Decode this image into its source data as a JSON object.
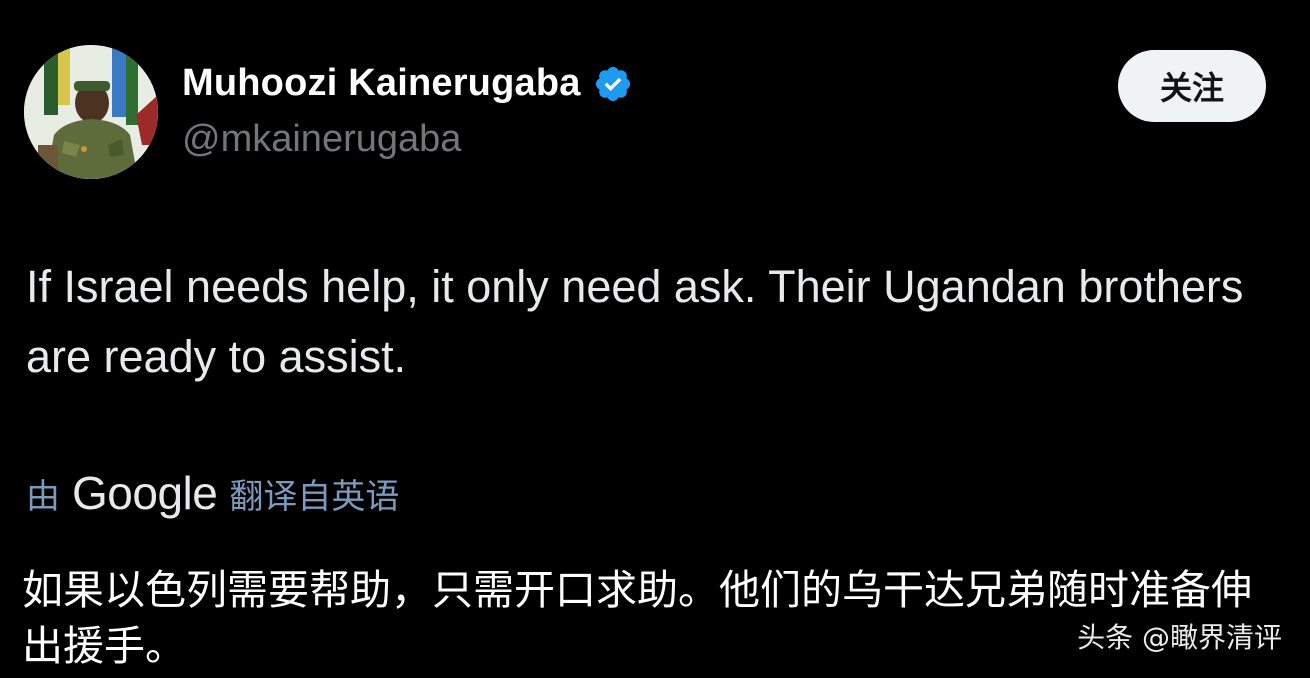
{
  "author": {
    "display_name": "Muhoozi Kainerugaba",
    "handle": "@mkainerugaba",
    "verified": true,
    "avatar_icon": "avatar-photo-icon",
    "verified_icon": "verified-badge-icon"
  },
  "follow_button": {
    "label": "关注"
  },
  "tweet": {
    "text": "If Israel needs help, it only need ask. Their Ugandan brothers are ready to assist."
  },
  "translation": {
    "prefix": "由",
    "provider": "Google",
    "link_label": "翻译自英语",
    "text": "如果以色列需要帮助，只需开口求助。他们的乌干达兄弟随时准备伸出援手。"
  },
  "watermark": {
    "text": "头条 @瞰界清评"
  },
  "colors": {
    "background": "#000000",
    "text_primary": "#e7e9ea",
    "text_secondary": "#71767b",
    "link": "#7a9bbd",
    "verified": "#1d9bf0",
    "button_bg": "#eff3f4"
  }
}
